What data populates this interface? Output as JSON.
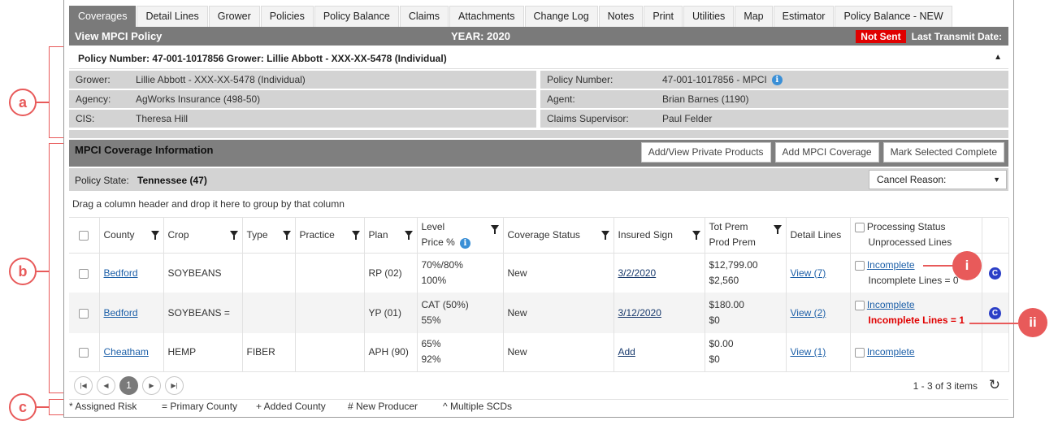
{
  "tabs": [
    "Coverages",
    "Detail Lines",
    "Grower",
    "Policies",
    "Policy Balance",
    "Claims",
    "Attachments",
    "Change Log",
    "Notes",
    "Print",
    "Utilities",
    "Map",
    "Estimator",
    "Policy Balance - NEW"
  ],
  "title": {
    "left": "View MPCI Policy",
    "year": "YEAR: 2020",
    "status": "Not Sent",
    "transmit": "Last Transmit Date:"
  },
  "policy_header": "Policy Number: 47-001-1017856 Grower: Lillie Abbott - XXX-XX-5478 (Individual)",
  "info": [
    {
      "l_label": "Grower:",
      "l_value": "Lillie Abbott - XXX-XX-5478 (Individual)",
      "r_label": "Policy Number:",
      "r_value": "47-001-1017856 - MPCI"
    },
    {
      "l_label": "Agency:",
      "l_value": "AgWorks Insurance (498-50)",
      "r_label": "Agent:",
      "r_value": "Brian Barnes (1190)"
    },
    {
      "l_label": "CIS:",
      "l_value": "Theresa Hill",
      "r_label": "Claims Supervisor:",
      "r_value": "Paul Felder"
    }
  ],
  "coverage": {
    "title": "MPCI Coverage Information",
    "buttons": [
      "Add/View Private Products",
      "Add MPCI Coverage",
      "Mark Selected Complete"
    ],
    "state_label": "Policy State:",
    "state_value": "Tennessee (47)",
    "cancel_reason": "Cancel Reason:",
    "group_hint": "Drag a column header and drop it here to group by that column"
  },
  "columns": {
    "county": "County",
    "crop": "Crop",
    "type": "Type",
    "practice": "Practice",
    "plan": "Plan",
    "level1": "Level",
    "level2": "Price %",
    "status": "Coverage Status",
    "sign": "Insured Sign",
    "prem1": "Tot Prem",
    "prem2": "Prod Prem",
    "detail": "Detail Lines",
    "proc1": "Processing Status",
    "proc2": "Unprocessed Lines"
  },
  "rows": [
    {
      "county": "Bedford",
      "crop": "SOYBEANS",
      "type": "",
      "practice": "",
      "plan": "RP (02)",
      "level1": "70%/80%",
      "level2": "100%",
      "status": "New",
      "sign": "3/2/2020",
      "prem1": "$12,799.00",
      "prem2": "$2,560",
      "detail": "View (7)",
      "proc": "Incomplete",
      "proc_lines": "Incomplete Lines = 0",
      "badge": "C"
    },
    {
      "county": "Bedford",
      "crop": "SOYBEANS =",
      "type": "",
      "practice": "",
      "plan": "YP (01)",
      "level1": "CAT (50%)",
      "level2": "55%",
      "status": "New",
      "sign": "3/12/2020",
      "prem1": "$180.00",
      "prem2": "$0",
      "detail": "View (2)",
      "proc": "Incomplete",
      "proc_lines": "Incomplete Lines = 1",
      "badge": "C"
    },
    {
      "county": "Cheatham",
      "crop": "HEMP",
      "type": "FIBER",
      "practice": "",
      "plan": "APH (90)",
      "level1": "65%",
      "level2": "92%",
      "status": "New",
      "sign": "Add",
      "prem1": "$0.00",
      "prem2": "$0",
      "detail": "View (1)",
      "proc": "Incomplete",
      "proc_lines": "",
      "badge": ""
    }
  ],
  "pager": {
    "page": "1",
    "items": "1 - 3 of 3 items"
  },
  "legend": [
    "* Assigned Risk",
    "= Primary County",
    "+ Added County",
    "# New Producer",
    "^ Multiple SCDs"
  ],
  "annotations": {
    "a": "a",
    "b": "b",
    "c": "c",
    "i": "i",
    "ii": "ii"
  },
  "colors": {
    "accent_red": "#e00000",
    "annotation": "#e85a5a",
    "header_gray": "#7a7a7a",
    "info_gray": "#d3d3d3",
    "link": "#1c5fa8",
    "badge": "#2b3fc7"
  }
}
